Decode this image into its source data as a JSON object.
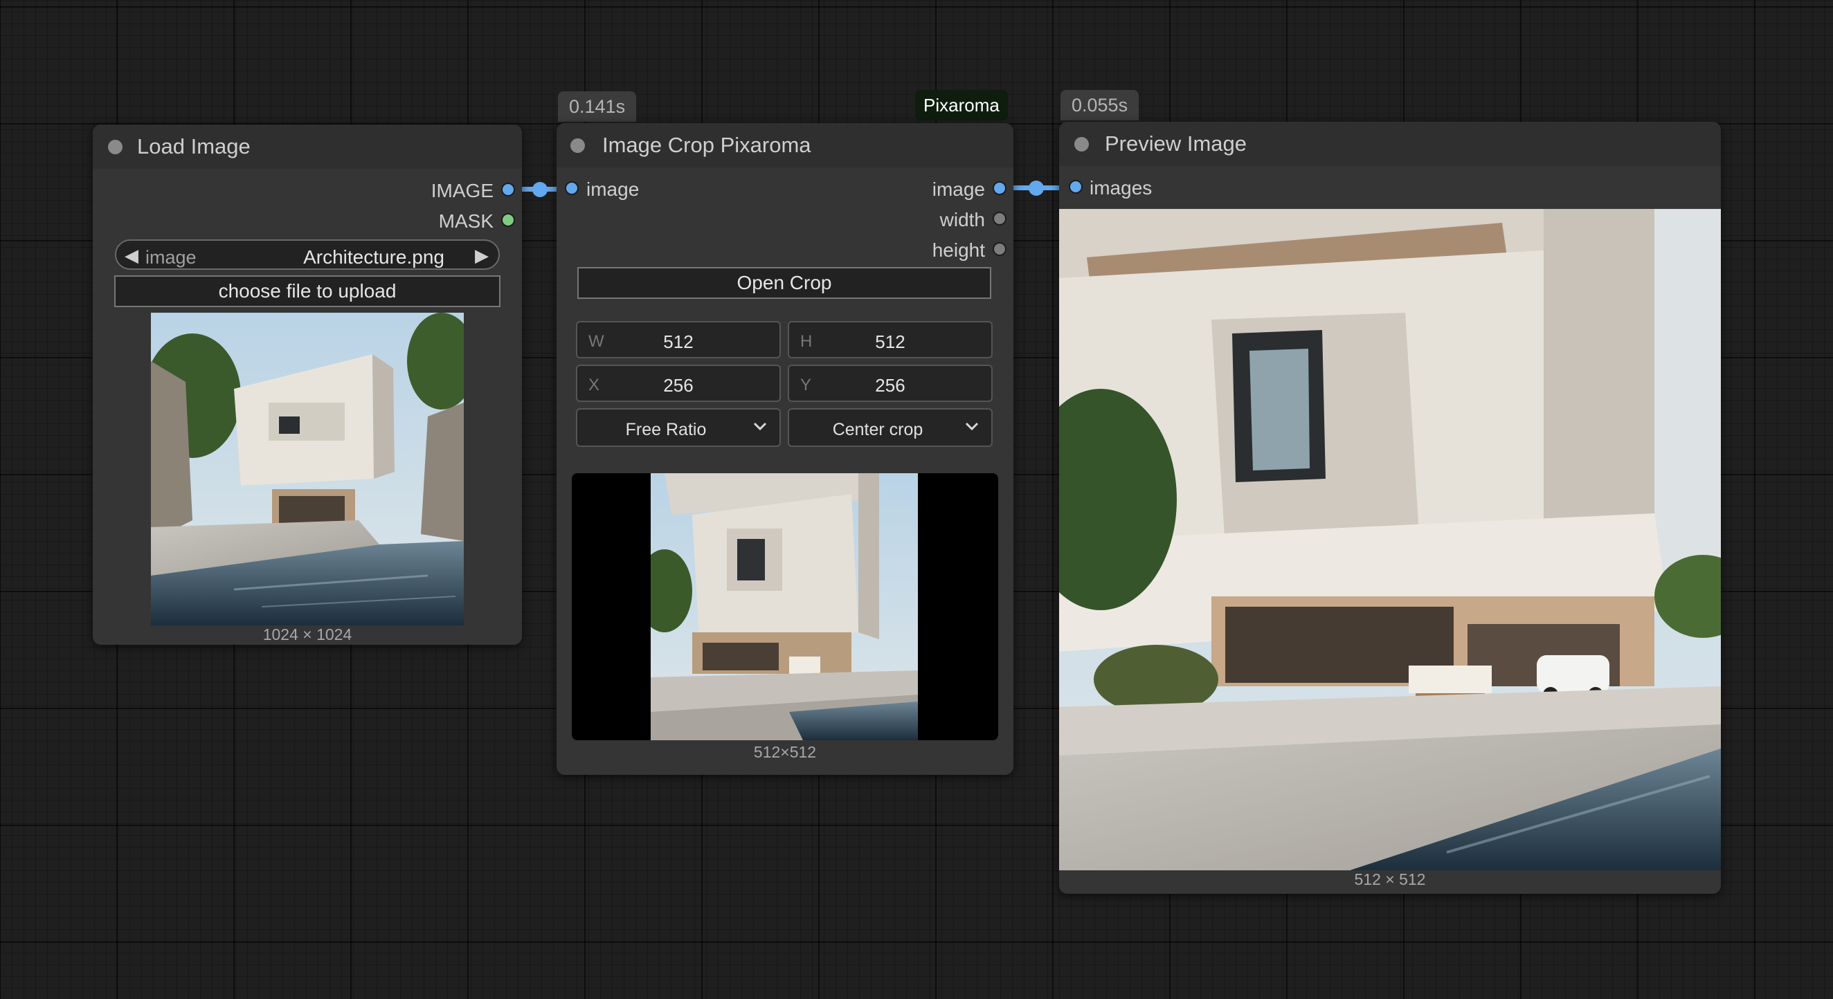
{
  "nodes": {
    "load_image": {
      "title": "Load Image",
      "outputs": [
        "IMAGE",
        "MASK"
      ],
      "image_widget": {
        "label": "image",
        "value": "Architecture.png"
      },
      "upload_label": "choose file to upload",
      "caption": "1024 × 1024"
    },
    "crop": {
      "title": "Image Crop Pixaroma",
      "badge": "0.141s",
      "tag": "Pixaroma",
      "input": "image",
      "outputs": [
        "image",
        "width",
        "height"
      ],
      "open_label": "Open Crop",
      "fields": [
        {
          "key": "W",
          "value": "512"
        },
        {
          "key": "H",
          "value": "512"
        },
        {
          "key": "X",
          "value": "256"
        },
        {
          "key": "Y",
          "value": "256"
        }
      ],
      "ratio": "Free Ratio",
      "mode": "Center crop",
      "caption": "512×512"
    },
    "preview": {
      "title": "Preview Image",
      "badge": "0.055s",
      "input": "images",
      "caption": "512 × 512"
    }
  },
  "colors": {
    "link": "#64a8ee",
    "mask": "#7fcc7f",
    "canvas": "#1f1f1f",
    "node": "#353535"
  },
  "icons": [
    "arrow-left-icon",
    "arrow-right-icon",
    "chevron-down-icon",
    "status-dot-icon"
  ]
}
